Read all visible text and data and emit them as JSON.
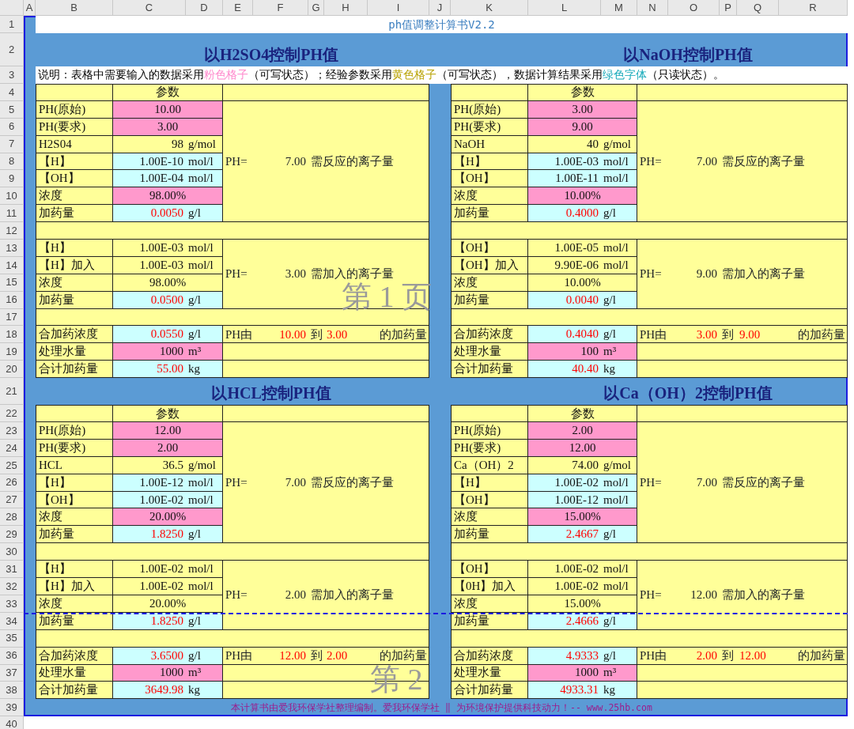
{
  "column_headers": [
    "A",
    "B",
    "C",
    "D",
    "E",
    "F",
    "G",
    "H",
    "I",
    "J",
    "K",
    "L",
    "M",
    "N",
    "O",
    "P",
    "Q",
    "R"
  ],
  "row_numbers": [
    "1",
    "2",
    "3",
    "4",
    "5",
    "6",
    "7",
    "8",
    "9",
    "10",
    "11",
    "12",
    "13",
    "14",
    "15",
    "16",
    "17",
    "18",
    "19",
    "20",
    "21",
    "22",
    "23",
    "24",
    "25",
    "26",
    "27",
    "28",
    "29",
    "30",
    "31",
    "32",
    "33",
    "34",
    "35",
    "36",
    "37",
    "38",
    "39",
    "40"
  ],
  "title": "ph值调整计算书V2.2",
  "legend": [
    {
      "text": "说明：表格中需要输入的数据采用",
      "color": "#000000"
    },
    {
      "text": "粉色格子",
      "color": "#ff88cc"
    },
    {
      "text": "（可写状态）；经验参数采用",
      "color": "#000000"
    },
    {
      "text": "黄色格子",
      "color": "#b8a200"
    },
    {
      "text": "（可写状态），数据计算结果采用",
      "color": "#000000"
    },
    {
      "text": "绿色字体",
      "color": "#12a8b8"
    },
    {
      "text": "（只读状态）。",
      "color": "#000000"
    }
  ],
  "blocks": [
    {
      "title": "以H2SO4控制PH值",
      "header": "参数",
      "sections": [
        {
          "rows": [
            {
              "label": "PH(原始)",
              "value": "10.00",
              "kind": "input"
            },
            {
              "label": "PH(要求)",
              "value": "3.00",
              "kind": "input"
            },
            {
              "label": "H2S04",
              "value": "98",
              "unit": "g/mol",
              "kind": "param"
            },
            {
              "label": "【H】",
              "value": "1.00E-10",
              "unit": "mol/l",
              "kind": "info"
            },
            {
              "label": "【OH】",
              "value": "1.00E-04",
              "unit": "mol/l",
              "kind": "info"
            },
            {
              "label": "浓度",
              "value": "98.00%",
              "kind": "input"
            },
            {
              "label": "加药量",
              "value": "0.0050",
              "unit": "g/l",
              "kind": "result"
            }
          ],
          "side": {
            "kind": "equation",
            "parts": [
              "PH=",
              "7.00",
              "需反应的离子量"
            ]
          }
        },
        {
          "rows": [
            {
              "label": "【H】",
              "value": "1.00E-03",
              "unit": "mol/l",
              "kind": "param"
            },
            {
              "label": "【H】加入",
              "value": "1.00E-03",
              "unit": "mol/l",
              "kind": "param"
            },
            {
              "label": "浓度",
              "value": "98.00%",
              "kind": "param"
            },
            {
              "label": "加药量",
              "value": "0.0500",
              "unit": "g/l",
              "kind": "result"
            }
          ],
          "side": {
            "kind": "equation",
            "parts": [
              "PH=",
              "3.00",
              "需加入的离子量"
            ]
          }
        },
        {
          "rows": [
            {
              "label": "合加药浓度",
              "value": "0.0550",
              "unit": "g/l",
              "kind": "result"
            },
            {
              "label": "处理水量",
              "value": "1000",
              "unit": "m³",
              "kind": "input"
            },
            {
              "label": "合计加药量",
              "value": "55.00",
              "unit": "kg",
              "kind": "result"
            }
          ],
          "side": {
            "kind": "range",
            "parts": [
              "PH由",
              "10.00",
              "到",
              "3.00",
              "的加药量"
            ]
          }
        }
      ]
    },
    {
      "title": "以NaOH控制PH值",
      "header": "参数",
      "sections": [
        {
          "rows": [
            {
              "label": "PH(原始)",
              "value": "3.00",
              "kind": "input"
            },
            {
              "label": "PH(要求)",
              "value": "9.00",
              "kind": "input"
            },
            {
              "label": "NaOH",
              "value": "40",
              "unit": "g/mol",
              "kind": "param"
            },
            {
              "label": "【H】",
              "value": "1.00E-03",
              "unit": "mol/l",
              "kind": "info"
            },
            {
              "label": "【OH】",
              "value": "1.00E-11",
              "unit": "mol/l",
              "kind": "info"
            },
            {
              "label": "浓度",
              "value": "10.00%",
              "kind": "input"
            },
            {
              "label": "加药量",
              "value": "0.4000",
              "unit": "g/l",
              "kind": "result"
            }
          ],
          "side": {
            "kind": "equation",
            "parts": [
              "PH=",
              "7.00",
              "需反应的离子量"
            ]
          }
        },
        {
          "rows": [
            {
              "label": "【OH】",
              "value": "1.00E-05",
              "unit": "mol/l",
              "kind": "param"
            },
            {
              "label": "【OH】加入",
              "value": "9.90E-06",
              "unit": "mol/l",
              "kind": "param"
            },
            {
              "label": "浓度",
              "value": "10.00%",
              "kind": "param"
            },
            {
              "label": "加药量",
              "value": "0.0040",
              "unit": "g/l",
              "kind": "result"
            }
          ],
          "side": {
            "kind": "equation",
            "parts": [
              "PH=",
              "9.00",
              "需加入的离子量"
            ]
          }
        },
        {
          "rows": [
            {
              "label": "合加药浓度",
              "value": "0.4040",
              "unit": "g/l",
              "kind": "result"
            },
            {
              "label": "处理水量",
              "value": "100",
              "unit": "m³",
              "kind": "input"
            },
            {
              "label": "合计加药量",
              "value": "40.40",
              "unit": "kg",
              "kind": "result"
            }
          ],
          "side": {
            "kind": "range",
            "parts": [
              "PH由",
              "3.00",
              "到",
              "9.00",
              "的加药量"
            ]
          }
        }
      ]
    },
    {
      "title": "以HCL控制PH值",
      "header": "参数",
      "sections": [
        {
          "rows": [
            {
              "label": "PH(原始)",
              "value": "12.00",
              "kind": "input"
            },
            {
              "label": "PH(要求)",
              "value": "2.00",
              "kind": "input"
            },
            {
              "label": "HCL",
              "value": "36.5",
              "unit": "g/mol",
              "kind": "param"
            },
            {
              "label": "【H】",
              "value": "1.00E-12",
              "unit": "mol/l",
              "kind": "info"
            },
            {
              "label": "【OH】",
              "value": "1.00E-02",
              "unit": "mol/l",
              "kind": "info"
            },
            {
              "label": "浓度",
              "value": "20.00%",
              "kind": "input"
            },
            {
              "label": "加药量",
              "value": "1.8250",
              "unit": "g/l",
              "kind": "result"
            }
          ],
          "side": {
            "kind": "equation",
            "parts": [
              "PH=",
              "7.00",
              "需反应的离子量"
            ]
          }
        },
        {
          "rows": [
            {
              "label": "【H】",
              "value": "1.00E-02",
              "unit": "mol/l",
              "kind": "param"
            },
            {
              "label": "【H】加入",
              "value": "1.00E-02",
              "unit": "mol/l",
              "kind": "param"
            },
            {
              "label": "浓度",
              "value": "20.00%",
              "kind": "param"
            },
            {
              "label": "加药量",
              "value": "1.8250",
              "unit": "g/l",
              "kind": "result"
            }
          ],
          "side": {
            "kind": "equation",
            "parts": [
              "PH=",
              "2.00",
              "需加入的离子量"
            ]
          }
        },
        {
          "rows": [
            {
              "label": "合加药浓度",
              "value": "3.6500",
              "unit": "g/l",
              "kind": "result"
            },
            {
              "label": "处理水量",
              "value": "1000",
              "unit": "m³",
              "kind": "input"
            },
            {
              "label": "合计加药量",
              "value": "3649.98",
              "unit": "kg",
              "kind": "result"
            }
          ],
          "side": {
            "kind": "range",
            "parts": [
              "PH由",
              "12.00",
              "到",
              "2.00",
              "的加药量"
            ]
          }
        }
      ]
    },
    {
      "title": "以Ca（OH）2控制PH值",
      "header": "参数",
      "sections": [
        {
          "rows": [
            {
              "label": "PH(原始)",
              "value": "2.00",
              "kind": "input"
            },
            {
              "label": "PH(要求)",
              "value": "12.00",
              "kind": "input"
            },
            {
              "label": "Ca（OH）2",
              "value": "74.00",
              "unit": "g/mol",
              "kind": "param"
            },
            {
              "label": "【H】",
              "value": "1.00E-02",
              "unit": "mol/l",
              "kind": "info"
            },
            {
              "label": "【OH】",
              "value": "1.00E-12",
              "unit": "mol/l",
              "kind": "info"
            },
            {
              "label": "浓度",
              "value": "15.00%",
              "kind": "input"
            },
            {
              "label": "加药量",
              "value": "2.4667",
              "unit": "g/l",
              "kind": "result"
            }
          ],
          "side": {
            "kind": "equation",
            "parts": [
              "PH=",
              "7.00",
              "需反应的离子量"
            ]
          }
        },
        {
          "rows": [
            {
              "label": "【OH】",
              "value": "1.00E-02",
              "unit": "mol/l",
              "kind": "param"
            },
            {
              "label": "【0H】加入",
              "value": "1.00E-02",
              "unit": "mol/l",
              "kind": "param"
            },
            {
              "label": "浓度",
              "value": "15.00%",
              "kind": "param"
            },
            {
              "label": "加药量",
              "value": "2.4666",
              "unit": "g/l",
              "kind": "result"
            }
          ],
          "side": {
            "kind": "equation",
            "parts": [
              "PH=",
              "12.00",
              "需加入的离子量"
            ]
          }
        },
        {
          "rows": [
            {
              "label": "合加药浓度",
              "value": "4.9333",
              "unit": "g/l",
              "kind": "result"
            },
            {
              "label": "处理水量",
              "value": "1000",
              "unit": "m³",
              "kind": "input"
            },
            {
              "label": "合计加药量",
              "value": "4933.31",
              "unit": "kg",
              "kind": "result"
            }
          ],
          "side": {
            "kind": "range",
            "parts": [
              "PH由",
              "2.00",
              "到",
              "12.00",
              "的加药量"
            ]
          }
        }
      ]
    }
  ],
  "page_labels": [
    "第 1 页",
    "第 2"
  ],
  "footer": "本计算书由爱我环保学社整理编制。爱我环保学社 ‖ 为环境保护提供科技动力！-- www.25hb.com"
}
